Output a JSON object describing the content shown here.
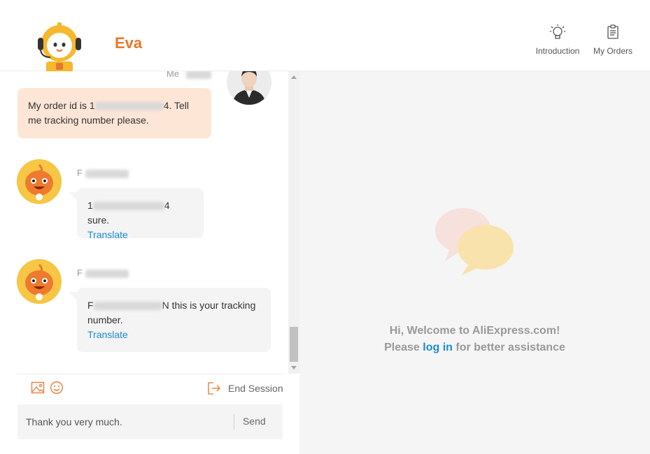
{
  "header": {
    "bot_name": "Eva",
    "introduction_label": "Introduction",
    "my_orders_label": "My Orders"
  },
  "messages": [
    {
      "sender": "Me",
      "text_prefix": "My order id is 1",
      "text_suffix": "4. Tell me tracking number please."
    },
    {
      "sender": "F",
      "text_prefix": "1",
      "text_suffix": "4 sure.",
      "translate_label": "Translate"
    },
    {
      "sender": "F",
      "text_prefix": "F",
      "text_suffix": "N this is your tracking number.",
      "translate_label": "Translate"
    }
  ],
  "composer": {
    "input_value": "Thank you very much.",
    "send_label": "Send",
    "end_session_label": "End Session"
  },
  "welcome": {
    "line1": "Hi, Welcome to AliExpress.com!",
    "line2_prefix": "Please ",
    "login_link": "log in",
    "line2_suffix": " for better assistance"
  },
  "colors": {
    "brand_orange": "#e8772e",
    "link_blue": "#1c8bd6",
    "my_bubble": "#fde6d6",
    "their_bubble": "#f4f4f4"
  }
}
